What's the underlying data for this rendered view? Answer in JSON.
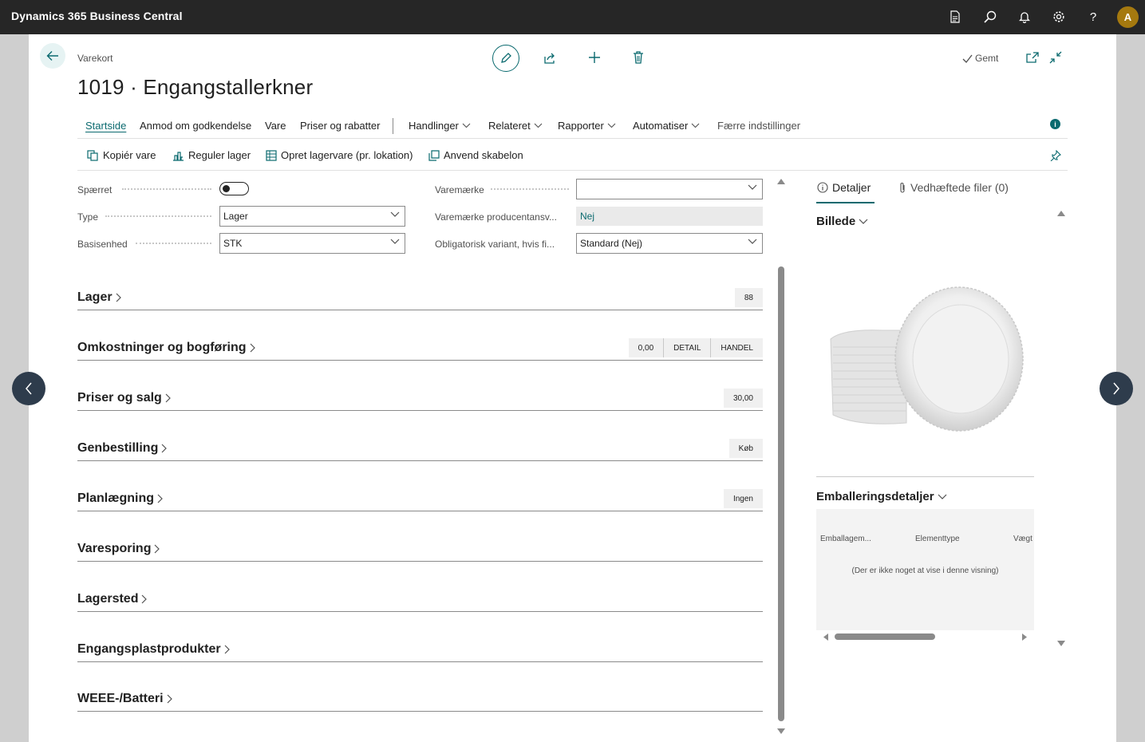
{
  "app": {
    "title": "Dynamics 365 Business Central",
    "avatar_initial": "A"
  },
  "topbar_icons": [
    "document-icon",
    "search-icon",
    "bell-icon",
    "gear-icon",
    "help-icon"
  ],
  "header": {
    "breadcrumb": "Varekort",
    "title": "1019 · Engangstallerkner",
    "saved_label": "Gemt"
  },
  "menu": {
    "items": [
      {
        "label": "Startside",
        "active": true
      },
      {
        "label": "Anmod om godkendelse"
      },
      {
        "label": "Vare"
      },
      {
        "label": "Priser og rabatter"
      },
      {
        "label": "Handlinger",
        "dropdown": true
      },
      {
        "label": "Relateret",
        "dropdown": true
      },
      {
        "label": "Rapporter",
        "dropdown": true
      },
      {
        "label": "Automatiser",
        "dropdown": true
      },
      {
        "label": "Færre indstillinger"
      }
    ]
  },
  "subactions": [
    {
      "label": "Kopiér vare"
    },
    {
      "label": "Reguler lager"
    },
    {
      "label": "Opret lagervare (pr. lokation)"
    },
    {
      "label": "Anvend skabelon"
    }
  ],
  "fields": {
    "blocked": {
      "label": "Spærret",
      "value": false
    },
    "type": {
      "label": "Type",
      "value": "Lager"
    },
    "base_unit": {
      "label": "Basisenhed",
      "value": "STK"
    },
    "brand": {
      "label": "Varemærke",
      "value": ""
    },
    "brand_producer": {
      "label": "Varemærke producentansv...",
      "value": "Nej"
    },
    "mandatory_variant": {
      "label": "Obligatorisk variant, hvis fi...",
      "value": "Standard (Nej)"
    }
  },
  "fasttabs": [
    {
      "title": "Lager",
      "chips": [
        "88"
      ]
    },
    {
      "title": "Omkostninger og bogføring",
      "chips": [
        "0,00",
        "DETAIL",
        "HANDEL"
      ]
    },
    {
      "title": "Priser og salg",
      "chips": [
        "30,00"
      ]
    },
    {
      "title": "Genbestilling",
      "chips": [
        "Køb"
      ]
    },
    {
      "title": "Planlægning",
      "chips": [
        "Ingen"
      ]
    },
    {
      "title": "Varesporing",
      "chips": []
    },
    {
      "title": "Lagersted",
      "chips": []
    },
    {
      "title": "Engangsplastprodukter",
      "chips": []
    },
    {
      "title": "WEEE-/Batteri",
      "chips": []
    }
  ],
  "factbox": {
    "tab_details": "Detaljer",
    "tab_attachments": "Vedhæftede filer (0)",
    "picture_title": "Billede",
    "packaging_title": "Emballeringsdetaljer",
    "columns": [
      "Emballagem...",
      "Elementtype",
      "Vægt"
    ],
    "empty_text": "(Der er ikke noget at vise i denne visning)"
  },
  "colors": {
    "accent": "#0b6a6f",
    "topbar": "#262626",
    "nav_button": "#2e3c4c",
    "avatar": "#a5790f"
  }
}
